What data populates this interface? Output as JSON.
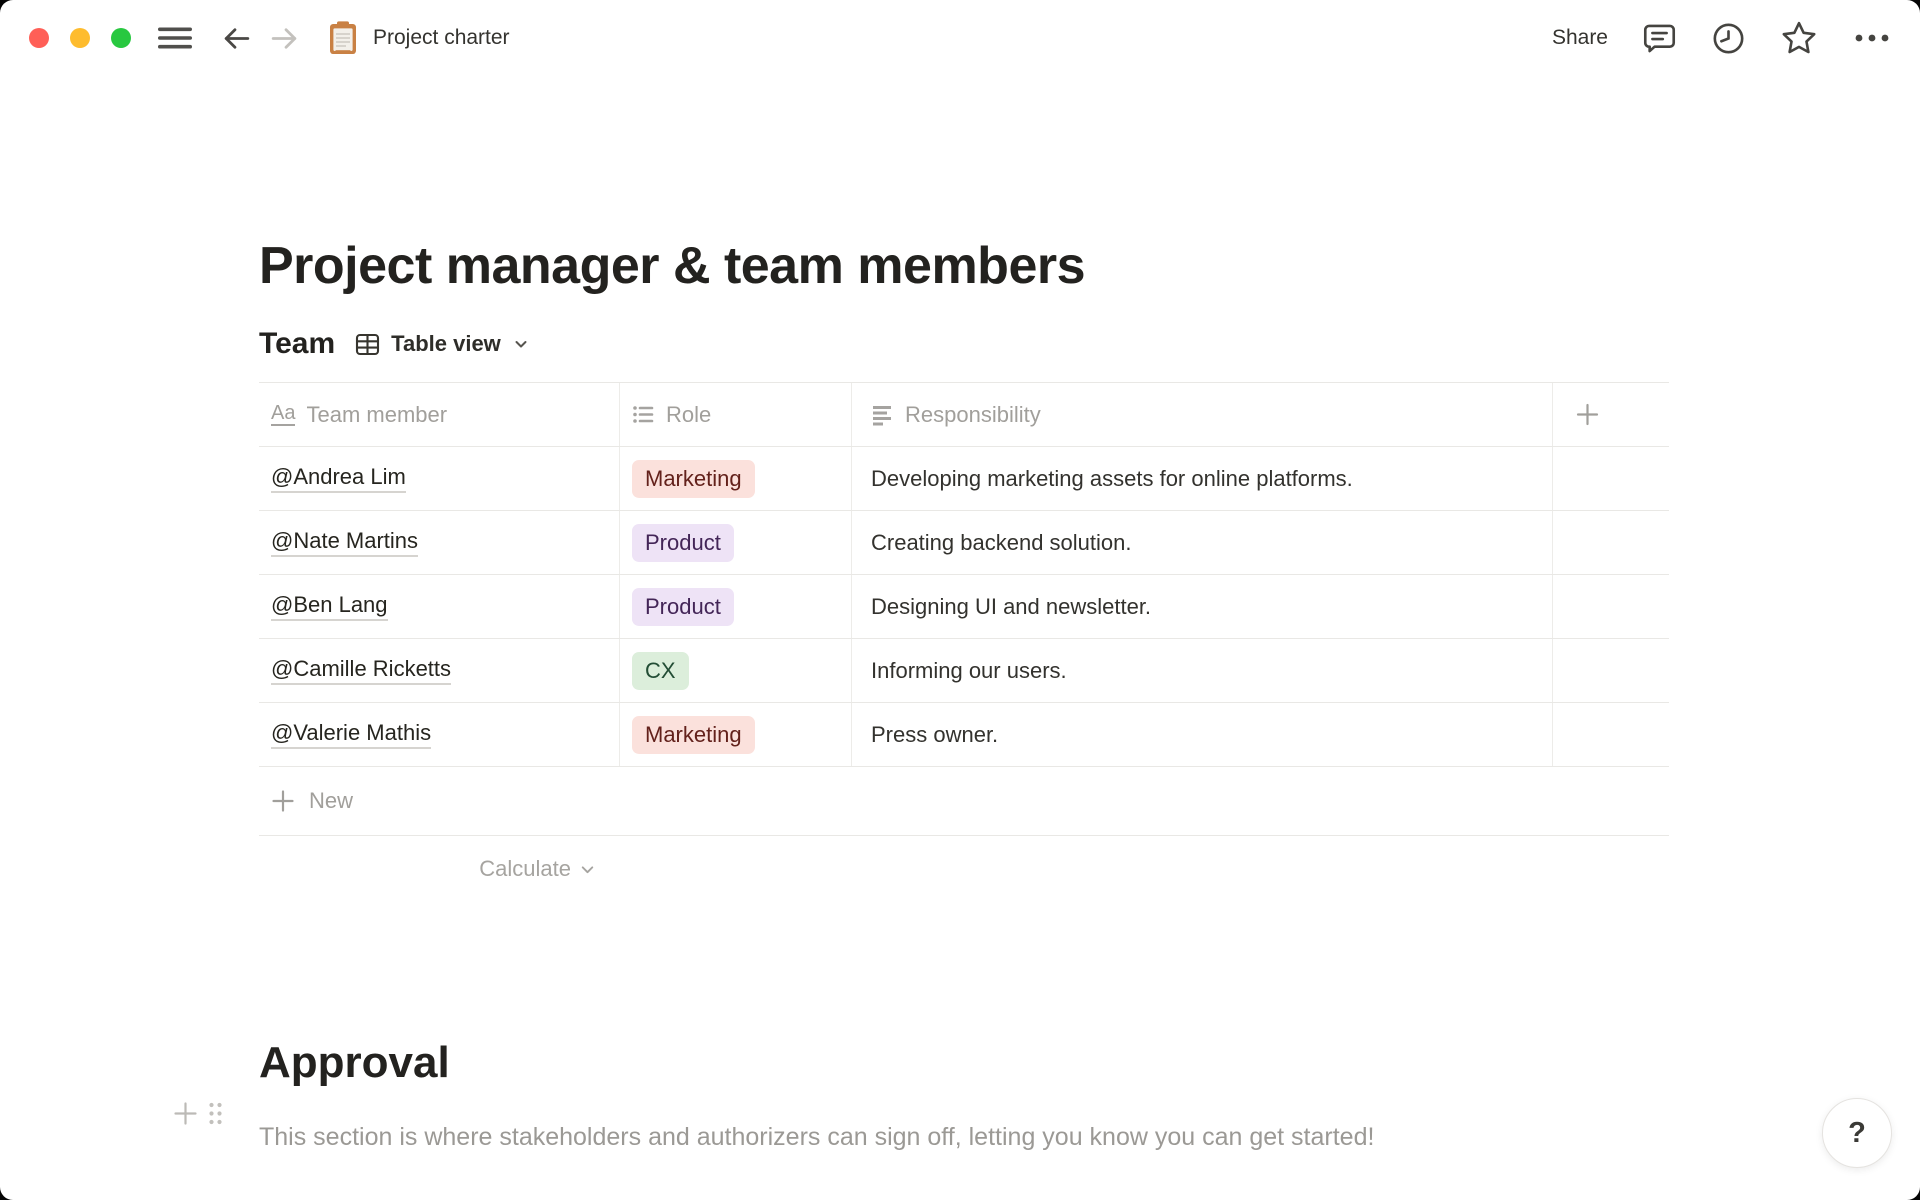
{
  "topbar": {
    "traffic_lights": {
      "close_color": "#FF5F57",
      "minimize_color": "#FEBC2E",
      "zoom_color": "#28C840"
    },
    "doc_title": "Project charter",
    "share_label": "Share"
  },
  "page": {
    "title": "Project manager & team members",
    "team_section": {
      "heading": "Team",
      "view_label": "Table view"
    },
    "table": {
      "columns": [
        {
          "label": "Team member",
          "type": "title"
        },
        {
          "label": "Role",
          "type": "select"
        },
        {
          "label": "Responsibility",
          "type": "text"
        }
      ],
      "rows": [
        {
          "member": "@Andrea Lim",
          "role": "Marketing",
          "role_color": "red",
          "responsibility": "Developing marketing assets for online platforms."
        },
        {
          "member": "@Nate Martins",
          "role": "Product",
          "role_color": "purple",
          "responsibility": "Creating backend solution."
        },
        {
          "member": "@Ben Lang",
          "role": "Product",
          "role_color": "purple",
          "responsibility": "Designing UI and newsletter."
        },
        {
          "member": "@Camille Ricketts",
          "role": "CX",
          "role_color": "green",
          "responsibility": "Informing our users."
        },
        {
          "member": "@Valerie Mathis",
          "role": "Marketing",
          "role_color": "red",
          "responsibility": "Press owner."
        }
      ],
      "new_row_label": "New",
      "calculate_label": "Calculate"
    },
    "approval_section": {
      "heading": "Approval",
      "paragraph": "This section is where stakeholders and authorizers can sign off, letting you know you can get started!"
    }
  },
  "help": {
    "label": "?"
  },
  "colors": {
    "tag_red_bg": "#FBE1DC",
    "tag_red_text": "#63211B",
    "tag_purple_bg": "#EEE3F6",
    "tag_purple_text": "#432557",
    "tag_green_bg": "#DCEEDB",
    "tag_green_text": "#234D35"
  },
  "icons": {
    "hamburger-icon": "☰",
    "back-icon": "←",
    "forward-icon": "→",
    "clipboard-icon": "📋",
    "comment-icon": "💬",
    "history-icon": "🕘",
    "star-icon": "☆",
    "more-icon": "⋯",
    "table-icon": "⊞",
    "chevron-down-icon": "⌄",
    "text-type-icon": "Aa",
    "select-icon": "≔",
    "text-icon": "≣",
    "plus-icon": "+",
    "drag-handle-icon": "⠿",
    "help-icon": "?"
  }
}
